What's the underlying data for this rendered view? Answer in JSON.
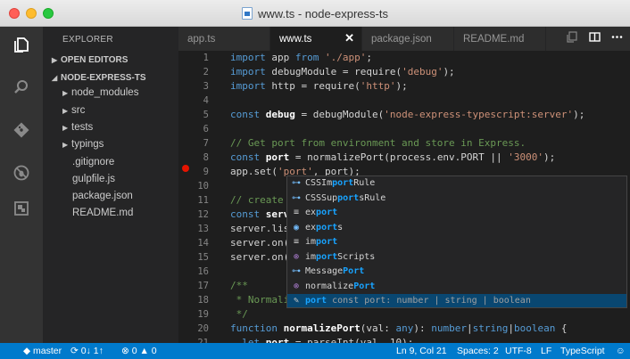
{
  "window": {
    "title": "www.ts - node-express-ts"
  },
  "sidebar": {
    "title": "EXPLORER",
    "sections": {
      "open_editors": "OPEN EDITORS",
      "project": "NODE-EXPRESS-TS"
    },
    "items": [
      {
        "label": "node_modules"
      },
      {
        "label": "src"
      },
      {
        "label": "tests"
      },
      {
        "label": "typings"
      },
      {
        "label": ".gitignore"
      },
      {
        "label": "gulpfile.js"
      },
      {
        "label": "package.json"
      },
      {
        "label": "README.md"
      }
    ]
  },
  "tabs": [
    {
      "label": "app.ts"
    },
    {
      "label": "www.ts",
      "close": "✕"
    },
    {
      "label": "package.json"
    },
    {
      "label": "README.md"
    }
  ],
  "editor": {
    "line_numbers": [
      "1",
      "2",
      "3",
      "4",
      "5",
      "6",
      "7",
      "8",
      "9",
      "10",
      "11",
      "12",
      "13",
      "14",
      "15",
      "16",
      "17",
      "18",
      "19",
      "20",
      "21"
    ],
    "lines": {
      "l1": {
        "a": "import",
        "b": " app ",
        "c": "from",
        "d": " ",
        "e": "'./app'",
        "f": ";"
      },
      "l2": {
        "a": "import",
        "b": " debugModule = require(",
        "c": "'debug'",
        "d": ");"
      },
      "l3": {
        "a": "import",
        "b": " http = require(",
        "c": "'http'",
        "d": ");"
      },
      "l5": {
        "a": "const",
        "b": " ",
        "c": "debug",
        "d": " = debugModule(",
        "e": "'node-express-typescript:server'",
        "f": ");"
      },
      "l7": "// Get port from environment and store in Express.",
      "l8": {
        "a": "const",
        "b": " ",
        "c": "port",
        "d": " = normalizePort(process.env.PORT || ",
        "e": "'3000'",
        "f": ");"
      },
      "l9": {
        "a": "app.set(",
        "b": "'port'",
        "c": ", port",
        "d": ");"
      },
      "l11": {
        "a": "// create ",
        "b": ""
      },
      "l12": {
        "a": "const",
        "b": " ",
        "c": "serv"
      },
      "l13": {
        "a": "server.list"
      },
      "l14": {
        "a": "server.on("
      },
      "l15": {
        "a": "server.on("
      },
      "l17": "/**",
      "l18": " * Normali",
      "l19": " */",
      "l20": {
        "a": "function",
        "b": " ",
        "c": "normalizePort",
        "d": "(val: ",
        "e": "any",
        "f": "): ",
        "g": "number",
        "h": "|",
        "i": "string",
        "j": "|",
        "k": "boolean",
        "l": " {"
      },
      "l21": {
        "a": "  ",
        "b": "let",
        "c": " ",
        "d": "port",
        "e": " = parseInt(val, 10);"
      }
    }
  },
  "suggest": {
    "items": [
      {
        "pre": "CSSIm",
        "match": "port",
        "post": "Rule",
        "icon": "property-icon"
      },
      {
        "pre": "CSSSup",
        "match": "port",
        "post": "sRule",
        "icon": "property-icon"
      },
      {
        "pre": "ex",
        "match": "port",
        "post": "",
        "icon": "keyword-icon"
      },
      {
        "pre": "ex",
        "match": "port",
        "post": "s",
        "icon": "module-icon"
      },
      {
        "pre": "im",
        "match": "port",
        "post": "",
        "icon": "keyword-icon"
      },
      {
        "pre": "im",
        "match": "port",
        "post": "Scripts",
        "icon": "method-icon"
      },
      {
        "pre": "Message",
        "match": "Port",
        "post": "",
        "icon": "property-icon"
      },
      {
        "pre": "normalize",
        "match": "Port",
        "post": "",
        "icon": "method-icon"
      },
      {
        "pre": "",
        "match": "port",
        "post": "",
        "detail": "const port: number | string | boolean",
        "icon": "wrench-icon"
      }
    ]
  },
  "status": {
    "branch": "master",
    "sync": "0↓ 1↑",
    "errors": "0",
    "warnings": "0",
    "position": "Ln 9, Col 21",
    "spaces": "Spaces: 2",
    "encoding": "UTF-8",
    "eol": "LF",
    "language": "TypeScript"
  },
  "colors": {
    "accent": "#007acc",
    "breakpoint": "#e51400",
    "match": "#18a3ff"
  }
}
